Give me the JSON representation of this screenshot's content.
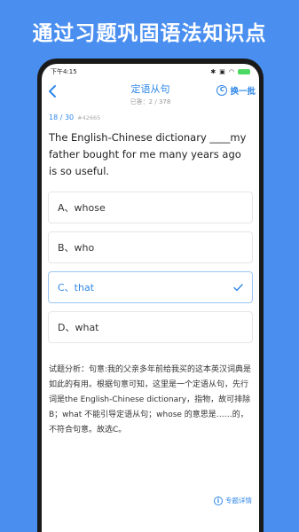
{
  "headline": "通过习题巩固语法知识点",
  "status": {
    "time": "下午4:15",
    "icons": [
      "bluetooth-icon",
      "sim-icon",
      "wifi-icon",
      "battery-icon"
    ]
  },
  "nav": {
    "title": "定语从句",
    "answered": "已答：2 / 378",
    "swap_label": "换一批"
  },
  "progress": {
    "current": "18 / 30",
    "qid": "#42665"
  },
  "question": "The English-Chinese dictionary ____my father bought for me many years ago is so useful.",
  "options": [
    {
      "label": "A、whose",
      "selected": false
    },
    {
      "label": "B、who",
      "selected": false
    },
    {
      "label": "C、that",
      "selected": true
    },
    {
      "label": "D、what",
      "selected": false
    }
  ],
  "analysis": "试题分析：句意:我的父亲多年前给我买的这本英汉词典是如此的有用。根据句意可知，这里是一个定语从句，先行词是the English-Chinese dictionary，指物，故可排除B；what 不能引导定语从句；whose 的意思是……的，不符合句意。故选C。",
  "detail_link": "专题详情",
  "colors": {
    "accent": "#2f87e8",
    "background": "#4a8ff0"
  }
}
